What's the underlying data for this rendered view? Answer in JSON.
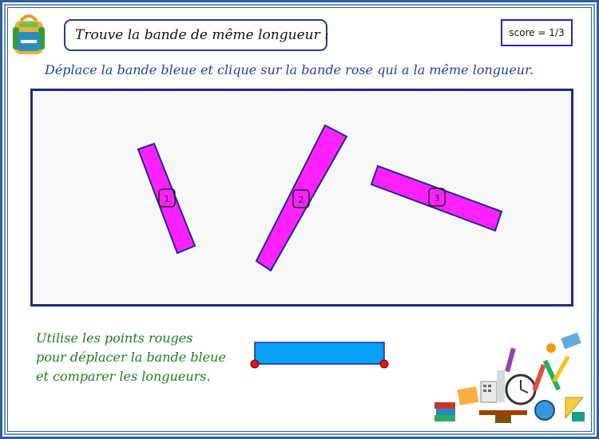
{
  "header": {
    "title": "Trouve la bande de même longueur :",
    "score": "score = 1/3"
  },
  "instruction": "Déplace la bande bleue et clique sur la bande rose qui a la même longueur.",
  "strips": [
    {
      "label": "1"
    },
    {
      "label": "2"
    },
    {
      "label": "3"
    }
  ],
  "hint": {
    "lines": [
      "Utilise les points rouges",
      "pour déplacer la bande bleue",
      "et comparer les longueurs."
    ]
  },
  "colors": {
    "pink_strip": "#ff22ff",
    "blue_strip": "#0aa0f5",
    "control_point": "#ee1111",
    "outline": "#1a2a8a"
  },
  "icons": {
    "logo": "backpack-icon",
    "decoration": "school-supplies-illustration"
  }
}
